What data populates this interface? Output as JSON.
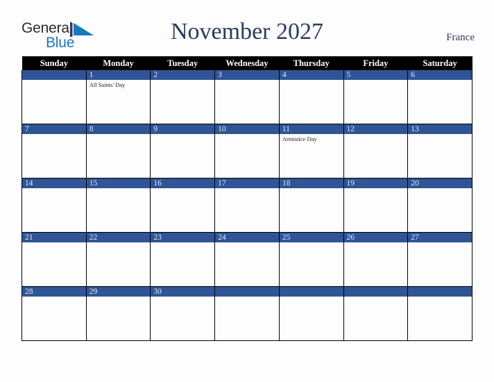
{
  "logo": {
    "word1": "General",
    "word2": "Blue",
    "mark_icon": "triangle-mark-icon",
    "word1_color": "#2b2b2b",
    "word2_color": "#1878bd",
    "mark_color": "#1878bd"
  },
  "header": {
    "title": "November 2027",
    "country": "France",
    "title_color": "#2b3b5e"
  },
  "calendar": {
    "weekday_headers": [
      "Sunday",
      "Monday",
      "Tuesday",
      "Wednesday",
      "Thursday",
      "Friday",
      "Saturday"
    ],
    "header_bg": "#000000",
    "header_text_color": "#ffffff",
    "daynum_bar_color": "#2f5596",
    "daynum_text_color": "#e8eaf0",
    "grid_line_color": "#000000",
    "cell_bg": "#fdfdfd",
    "weeks": [
      [
        {
          "day": "",
          "events": []
        },
        {
          "day": "1",
          "events": [
            "All Saints' Day"
          ]
        },
        {
          "day": "2",
          "events": []
        },
        {
          "day": "3",
          "events": []
        },
        {
          "day": "4",
          "events": []
        },
        {
          "day": "5",
          "events": []
        },
        {
          "day": "6",
          "events": []
        }
      ],
      [
        {
          "day": "7",
          "events": []
        },
        {
          "day": "8",
          "events": []
        },
        {
          "day": "9",
          "events": []
        },
        {
          "day": "10",
          "events": []
        },
        {
          "day": "11",
          "events": [
            "Armistice Day"
          ]
        },
        {
          "day": "12",
          "events": []
        },
        {
          "day": "13",
          "events": []
        }
      ],
      [
        {
          "day": "14",
          "events": []
        },
        {
          "day": "15",
          "events": []
        },
        {
          "day": "16",
          "events": []
        },
        {
          "day": "17",
          "events": []
        },
        {
          "day": "18",
          "events": []
        },
        {
          "day": "19",
          "events": []
        },
        {
          "day": "20",
          "events": []
        }
      ],
      [
        {
          "day": "21",
          "events": []
        },
        {
          "day": "22",
          "events": []
        },
        {
          "day": "23",
          "events": []
        },
        {
          "day": "24",
          "events": []
        },
        {
          "day": "25",
          "events": []
        },
        {
          "day": "26",
          "events": []
        },
        {
          "day": "27",
          "events": []
        }
      ],
      [
        {
          "day": "28",
          "events": []
        },
        {
          "day": "29",
          "events": []
        },
        {
          "day": "30",
          "events": []
        },
        {
          "day": "",
          "events": []
        },
        {
          "day": "",
          "events": []
        },
        {
          "day": "",
          "events": []
        },
        {
          "day": "",
          "events": []
        }
      ]
    ]
  }
}
